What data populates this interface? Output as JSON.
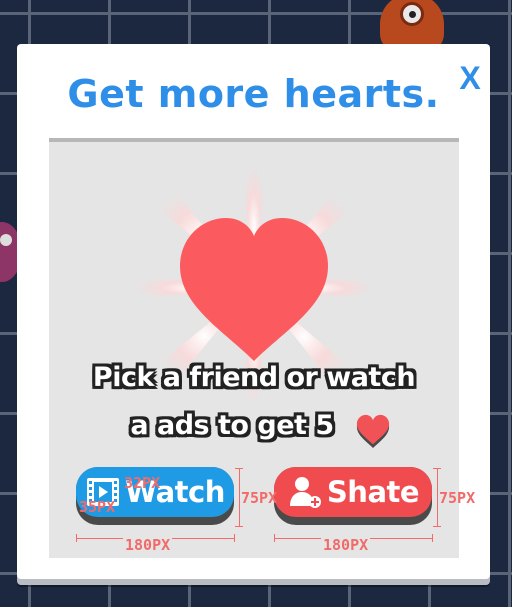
{
  "dialog": {
    "title": "Get more hearts.",
    "close_label": "X",
    "prompt_line1": "Pick a friend or watch",
    "prompt_line2": "a ads to get 5",
    "watch_button": {
      "label": "Watch",
      "icon": "film-icon"
    },
    "share_button": {
      "label": "Shate",
      "icon": "add-friend-icon"
    }
  },
  "annotations": {
    "icon_size": "32PX",
    "icon_size_2": "35PX",
    "watch_height": "75PX",
    "share_height": "75PX",
    "watch_width": "180PX",
    "share_width": "180PX"
  },
  "colors": {
    "background": "#1c2740",
    "title_blue": "#2f8ee8",
    "heart_red": "#fb5b5e",
    "watch_blue": "#1f9be6",
    "share_red": "#f04c4f",
    "annotation_red": "#f26a6a"
  }
}
